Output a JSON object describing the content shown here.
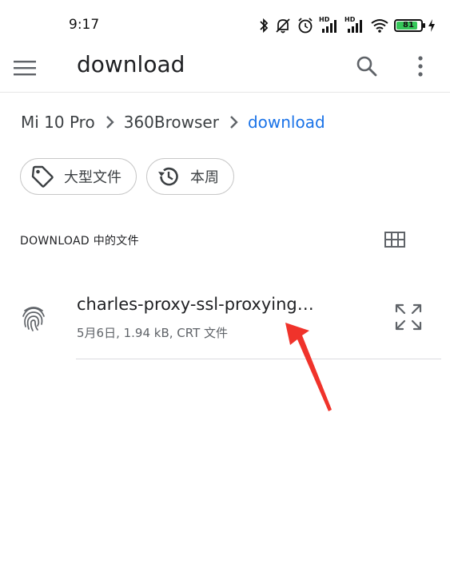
{
  "status_bar": {
    "time": "9:17",
    "icons": [
      "bluetooth-icon",
      "silent-icon",
      "alarm-icon",
      "hd-signal-icon",
      "hd-signal-icon",
      "wifi-icon",
      "battery-icon",
      "charging-icon"
    ],
    "hd_label": "HD",
    "battery_level": "81",
    "battery_color": "#35c759"
  },
  "app_bar": {
    "title": "download",
    "icons": [
      "menu-icon",
      "search-icon",
      "more-vert-icon"
    ]
  },
  "breadcrumb": {
    "items": [
      "Mi 10 Pro",
      "360Browser",
      "download"
    ],
    "active_color": "#1a73e8"
  },
  "filters": {
    "chips": [
      {
        "label": "大型文件",
        "icon": "tag-icon"
      },
      {
        "label": "本周",
        "icon": "history-icon"
      }
    ]
  },
  "section": {
    "title": "DOWNLOAD 中的文件",
    "view_icon": "grid-view-icon"
  },
  "files": [
    {
      "name": "charles-proxy-ssl-proxying…",
      "meta": "5月6日, 1.94 kB, CRT 文件",
      "icon": "fingerprint-icon",
      "action_icon": "expand-icon"
    }
  ],
  "annotation": {
    "color": "#f0332b"
  }
}
